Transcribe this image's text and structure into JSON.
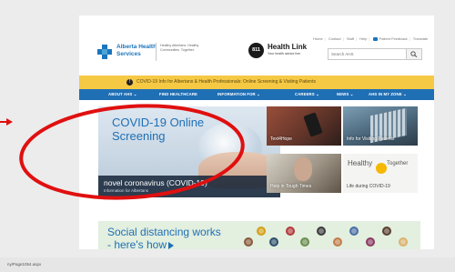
{
  "header": {
    "org_name_line1": "Alberta Health",
    "org_name_line2": "Services",
    "tagline": "Healthy Albertans. Healthy Communities. Together.",
    "healthlink_badge": "811",
    "healthlink_name": "Health Link",
    "healthlink_sub": "Your health advice line"
  },
  "utility_links": [
    "Home",
    "Contact",
    "Staff",
    "Help"
  ],
  "patient_feedback": "Patient Feedback",
  "translate_label": "Translate",
  "search": {
    "placeholder": "Search AHS"
  },
  "alert": {
    "icon": "!",
    "text": "COVID-19 Info for Albertans & Health Professionals: Online Screening & Visiting Patients"
  },
  "nav": [
    {
      "label": "ABOUT AHS ⌄"
    },
    {
      "label": "FIND HEALTHCARE"
    },
    {
      "label": "INFORMATION FOR ⌄"
    },
    {
      "label": "CAREERS ⌄"
    },
    {
      "label": "NEWS ⌄"
    },
    {
      "label": "AHS IN MY ZONE ⌄"
    }
  ],
  "hero": {
    "title": "COVID-19 Online Screening",
    "caption_title": "novel coronavirus (COVID-19)",
    "caption_sub": "Information for Albertans"
  },
  "tiles": [
    {
      "label": "Text4Hope"
    },
    {
      "label": "Info for Visiting Patients"
    },
    {
      "label": "Help in Tough Times"
    },
    {
      "label": "Life during COVID-19",
      "mark1": "Healthy",
      "mark2": "Together"
    }
  ],
  "banner": {
    "text": "Social distancing works - here's how"
  },
  "status_bar": {
    "text": "ny/Page1054.aspx"
  },
  "colors": {
    "brand_blue": "#1f6fb5",
    "alert_yellow": "#f6c945",
    "annotation_red": "#e01010"
  }
}
